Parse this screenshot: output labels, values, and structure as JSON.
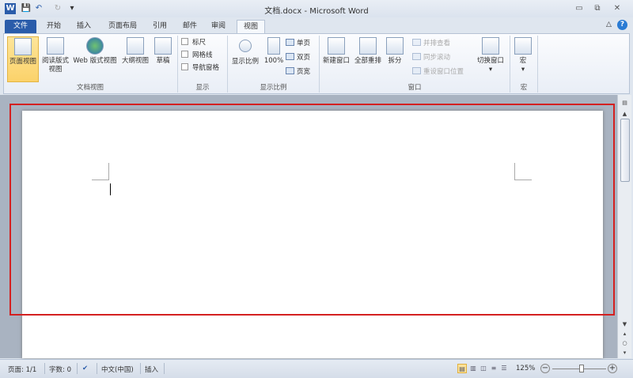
{
  "window": {
    "title": "文档.docx - Microsoft Word",
    "minimize": "▭",
    "restore": "⧉",
    "close": "✕",
    "help": "?",
    "collapse": "△"
  },
  "quick_access": {
    "word_icon": "W",
    "save": "💾",
    "undo": "↶",
    "redo": "↻",
    "customize": "▾"
  },
  "tabs": [
    "文件",
    "开始",
    "插入",
    "页面布局",
    "引用",
    "邮件",
    "审阅",
    "视图"
  ],
  "active_tab": "视图",
  "ribbon": {
    "doc_views": {
      "label": "文档视图",
      "items": [
        "页面视图",
        "阅读版式\n视图",
        "Web 版式视图",
        "大纲视图",
        "草稿"
      ]
    },
    "show": {
      "label": "显示",
      "items": [
        "标尺",
        "网格线",
        "导航窗格"
      ]
    },
    "zoom": {
      "label": "显示比例",
      "zoom": "显示比例",
      "percent": "100%",
      "one_page": "单页",
      "two_pages": "双页",
      "page_width": "页宽"
    },
    "window": {
      "label": "窗口",
      "new_window": "新建窗口",
      "arrange_all": "全部重排",
      "split": "拆分",
      "side_by_side": "并排查看",
      "sync_scroll": "同步滚动",
      "reset_position": "重设窗口位置",
      "switch_windows": "切换窗口"
    },
    "macros": {
      "label": "宏",
      "macros": "宏"
    }
  },
  "status": {
    "page": "页面: 1/1",
    "words": "字数: 0",
    "language": "中文(中国)",
    "mode": "插入",
    "zoom": "125%",
    "zoom_out": "−",
    "zoom_in": "+",
    "zoom_fraction": 0.55
  },
  "colors": {
    "file_tab": "#2a5caa",
    "highlight": "#d42020"
  }
}
